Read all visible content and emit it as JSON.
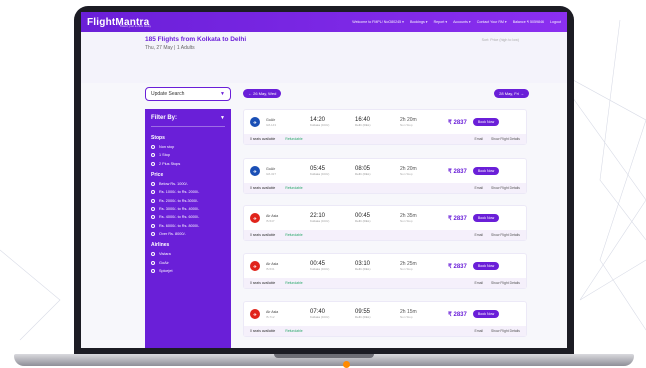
{
  "header": {
    "logo": "FlightMantra",
    "tagline": "Travel, just a click away",
    "nav": [
      "Welcome to FMPL/ NoO80245 ▾",
      "Bookings ▾",
      "Report ▾",
      "Accounts ▾",
      "Contact Your RM ▾",
      "Balance ₹ 5059846",
      "Logout"
    ]
  },
  "search": {
    "title": "185 Flights from Kolkata to Delhi",
    "subtitle": "Thu, 27 May | 1 Adults",
    "sort": "Sort: Price (high to low)",
    "update_label": "Update Search",
    "prev_date": "← 26 May, Wed",
    "next_date": "28 May, Fri →"
  },
  "filter": {
    "heading": "Filter By:",
    "stops_title": "Stops",
    "stops": [
      "Non stop",
      "1 Stop",
      "2 Plus Stops"
    ],
    "price_title": "Price",
    "prices": [
      "Below Rs. 1000/-",
      "Rs. 1000/- to Rs. 2000/-",
      "Rs. 2000/- to Rs.3000/-",
      "Rs. 3000/- to Rs. 4000/-",
      "Rs. 4000/- to Rs. 6000/-",
      "Rs. 6000/- to Rs. 8000/-",
      "Over Rs. 8000/-"
    ],
    "airlines_title": "Airlines",
    "airlines": [
      "Vistara",
      "GoAir",
      "Spicejet"
    ]
  },
  "flights": [
    {
      "airline": "GoAir",
      "code": "G8-143",
      "dep": "14:20",
      "dep_city": "Kolkata (CCU)",
      "arr": "16:40",
      "arr_city": "Delhi (DEL)",
      "dur": "2h 20m",
      "stops": "Non Stop",
      "price": "₹ 2837",
      "seats": "0 seats available",
      "refund": "Refundable",
      "email": "Email",
      "details": "Show Flight Details",
      "book": "Book Now",
      "color": "#1a4fb5"
    },
    {
      "airline": "GoAir",
      "code": "G8-327",
      "dep": "05:45",
      "dep_city": "Kolkata (CCU)",
      "arr": "08:05",
      "arr_city": "Delhi (DEL)",
      "dur": "2h 20m",
      "stops": "Non Stop",
      "price": "₹ 2837",
      "seats": "0 seats available",
      "refund": "Refundable",
      "email": "Email",
      "details": "Show Flight Details",
      "book": "Book Now",
      "color": "#1a4fb5"
    },
    {
      "airline": "Air Asia",
      "code": "I5-547",
      "dep": "22:10",
      "dep_city": "Kolkata (CCU)",
      "arr": "00:45",
      "arr_city": "Delhi (DEL)",
      "dur": "2h 35m",
      "stops": "Non Stop",
      "price": "₹ 2837",
      "seats": "0 seats available",
      "refund": "Refundable",
      "email": "Email",
      "details": "Show Flight Details",
      "book": "Book Now",
      "color": "#e0241b"
    },
    {
      "airline": "Air Asia",
      "code": "I5-531",
      "dep": "00:45",
      "dep_city": "Kolkata (CCU)",
      "arr": "03:10",
      "arr_city": "Delhi (DEL)",
      "dur": "2h 25m",
      "stops": "Non Stop",
      "price": "₹ 2837",
      "seats": "0 seats available",
      "refund": "Refundable",
      "email": "Email",
      "details": "Show Flight Details",
      "book": "Book Now",
      "color": "#e0241b"
    },
    {
      "airline": "Air Asia",
      "code": "I5-712",
      "dep": "07:40",
      "dep_city": "Kolkata (CCU)",
      "arr": "09:55",
      "arr_city": "Delhi (DEL)",
      "dur": "2h 15m",
      "stops": "Non Stop",
      "price": "₹ 2837",
      "seats": "0 seats available",
      "refund": "Refundable",
      "email": "Email",
      "details": "Show Flight Details",
      "book": "Book Now",
      "color": "#e0241b"
    }
  ]
}
